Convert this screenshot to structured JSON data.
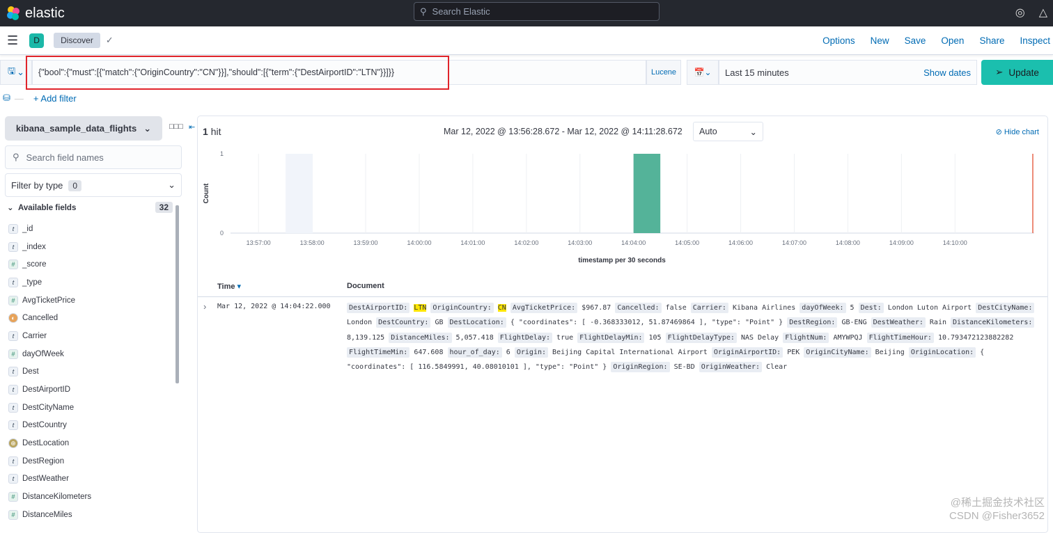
{
  "topbar": {
    "brand": "elastic",
    "search_placeholder": "Search Elastic",
    "icons": [
      "help-icon",
      "newsfeed-icon"
    ]
  },
  "nav": {
    "app_badge": "D",
    "breadcrumb": "Discover",
    "links": [
      "Options",
      "New",
      "Save",
      "Open",
      "Share",
      "Inspect"
    ]
  },
  "query": {
    "value": "{\"bool\":{\"must\":[{\"match\":{\"OriginCountry\":\"CN\"}}],\"should\":[{\"term\":{\"DestAirportID\":\"LTN\"}}]}}",
    "language": "Lucene",
    "time_range": "Last 15 minutes",
    "show_dates": "Show dates",
    "update": "Update",
    "add_filter": "+ Add filter"
  },
  "sidebar": {
    "index_pattern": "kibana_sample_data_flights",
    "search_placeholder": "Search field names",
    "filter_by_type": "Filter by type",
    "filter_count": "0",
    "available_fields": "Available fields",
    "available_count": "32",
    "fields": [
      {
        "type": "t",
        "name": "_id"
      },
      {
        "type": "t",
        "name": "_index"
      },
      {
        "type": "#",
        "name": "_score"
      },
      {
        "type": "t",
        "name": "_type"
      },
      {
        "type": "#",
        "name": "AvgTicketPrice"
      },
      {
        "type": "bool",
        "name": "Cancelled"
      },
      {
        "type": "t",
        "name": "Carrier"
      },
      {
        "type": "#",
        "name": "dayOfWeek"
      },
      {
        "type": "t",
        "name": "Dest"
      },
      {
        "type": "t",
        "name": "DestAirportID"
      },
      {
        "type": "t",
        "name": "DestCityName"
      },
      {
        "type": "t",
        "name": "DestCountry"
      },
      {
        "type": "geo",
        "name": "DestLocation"
      },
      {
        "type": "t",
        "name": "DestRegion"
      },
      {
        "type": "t",
        "name": "DestWeather"
      },
      {
        "type": "#",
        "name": "DistanceKilometers"
      },
      {
        "type": "#",
        "name": "DistanceMiles"
      }
    ]
  },
  "results": {
    "hits_count": "1",
    "hits_label": "hit",
    "range": "Mar 12, 2022 @ 13:56:28.672 - Mar 12, 2022 @ 14:11:28.672",
    "interval": "Auto",
    "hide_chart": "Hide chart",
    "columns": [
      "Time",
      "Document"
    ],
    "rows": [
      {
        "time": "Mar 12, 2022 @ 14:04:22.000",
        "fields": [
          [
            "DestAirportID:",
            "LTN",
            true
          ],
          [
            "OriginCountry:",
            "CN",
            true
          ],
          [
            "AvgTicketPrice:",
            "$967.87"
          ],
          [
            "Cancelled:",
            "false"
          ],
          [
            "Carrier:",
            "Kibana Airlines"
          ],
          [
            "dayOfWeek:",
            "5"
          ],
          [
            "Dest:",
            "London Luton Airport"
          ],
          [
            "DestCityName:",
            "London"
          ],
          [
            "DestCountry:",
            "GB"
          ],
          [
            "DestLocation:",
            "{ \"coordinates\": [ -0.368333012, 51.87469864 ], \"type\": \"Point\" }"
          ],
          [
            "DestRegion:",
            "GB-ENG"
          ],
          [
            "DestWeather:",
            "Rain"
          ],
          [
            "DistanceKilometers:",
            "8,139.125"
          ],
          [
            "DistanceMiles:",
            "5,057.418"
          ],
          [
            "FlightDelay:",
            "true"
          ],
          [
            "FlightDelayMin:",
            "105"
          ],
          [
            "FlightDelayType:",
            "NAS Delay"
          ],
          [
            "FlightNum:",
            "AMYWPQJ"
          ],
          [
            "FlightTimeHour:",
            "10.793472123882282"
          ],
          [
            "FlightTimeMin:",
            "647.608"
          ],
          [
            "hour_of_day:",
            "6"
          ],
          [
            "Origin:",
            "Beijing Capital International Airport"
          ],
          [
            "OriginAirportID:",
            "PEK"
          ],
          [
            "OriginCityName:",
            "Beijing"
          ],
          [
            "OriginLocation:",
            "{ \"coordinates\": [ 116.5849991, 40.08010101 ], \"type\": \"Point\" }"
          ],
          [
            "OriginRegion:",
            "SE-BD"
          ],
          [
            "OriginWeather:",
            "Clear"
          ]
        ]
      }
    ]
  },
  "chart_data": {
    "type": "bar",
    "xlabel": "timestamp per 30 seconds",
    "ylabel": "Count",
    "xlim": [
      "13:56:28.672",
      "14:11:28.672"
    ],
    "ylim": [
      0,
      1
    ],
    "yticks": [
      "0",
      "1"
    ],
    "xticks": [
      "13:57:00",
      "13:58:00",
      "13:59:00",
      "14:00:00",
      "14:01:00",
      "14:02:00",
      "14:03:00",
      "14:04:00",
      "14:05:00",
      "14:06:00",
      "14:07:00",
      "14:08:00",
      "14:09:00",
      "14:10:00"
    ],
    "bars": [
      {
        "x": "14:04:00",
        "value": 1
      }
    ],
    "bar_color": "#54b399",
    "now_marker_color": "#e7664c",
    "grid": true
  },
  "watermarks": [
    "@稀土掘金技术社区",
    "CSDN @Fisher3652"
  ]
}
